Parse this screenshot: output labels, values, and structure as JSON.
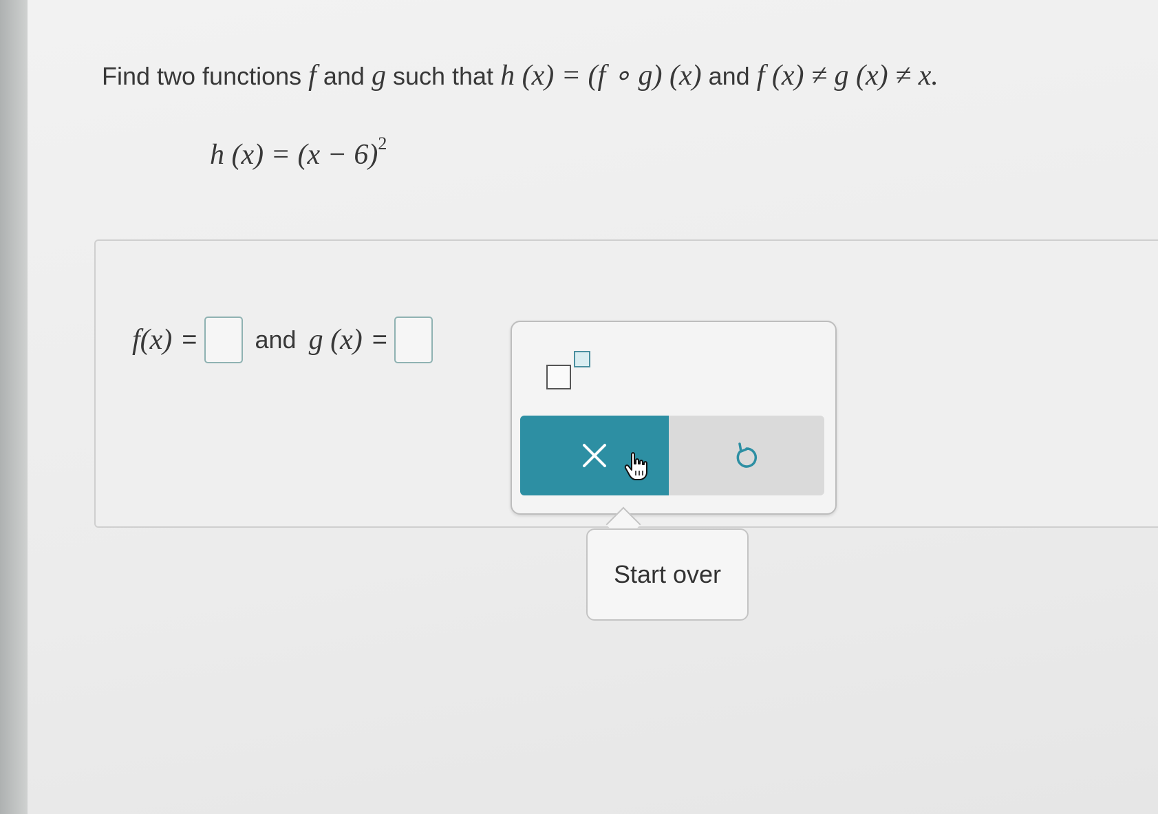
{
  "question": {
    "lead_text": "Find two functions",
    "f_symbol": "f",
    "and_1": "and",
    "g_symbol": "g",
    "such_that": "such that",
    "composition": "h (x) = (f ∘ g) (x)",
    "and_2": "and",
    "inequality": "f (x) ≠ g (x) ≠ x."
  },
  "given": {
    "lhs": "h (x) = (x − 6)",
    "exponent": "2"
  },
  "answer": {
    "f_label": "f(x)",
    "equals_1": "=",
    "and_word": "and",
    "g_label": "g (x)",
    "equals_2": "="
  },
  "palette": {
    "exponent_tool": "exponent-template",
    "clear_icon": "x-icon",
    "undo_icon": "undo-icon",
    "clear_color": "#2d8fa3"
  },
  "tooltip": {
    "text": "Start over"
  }
}
